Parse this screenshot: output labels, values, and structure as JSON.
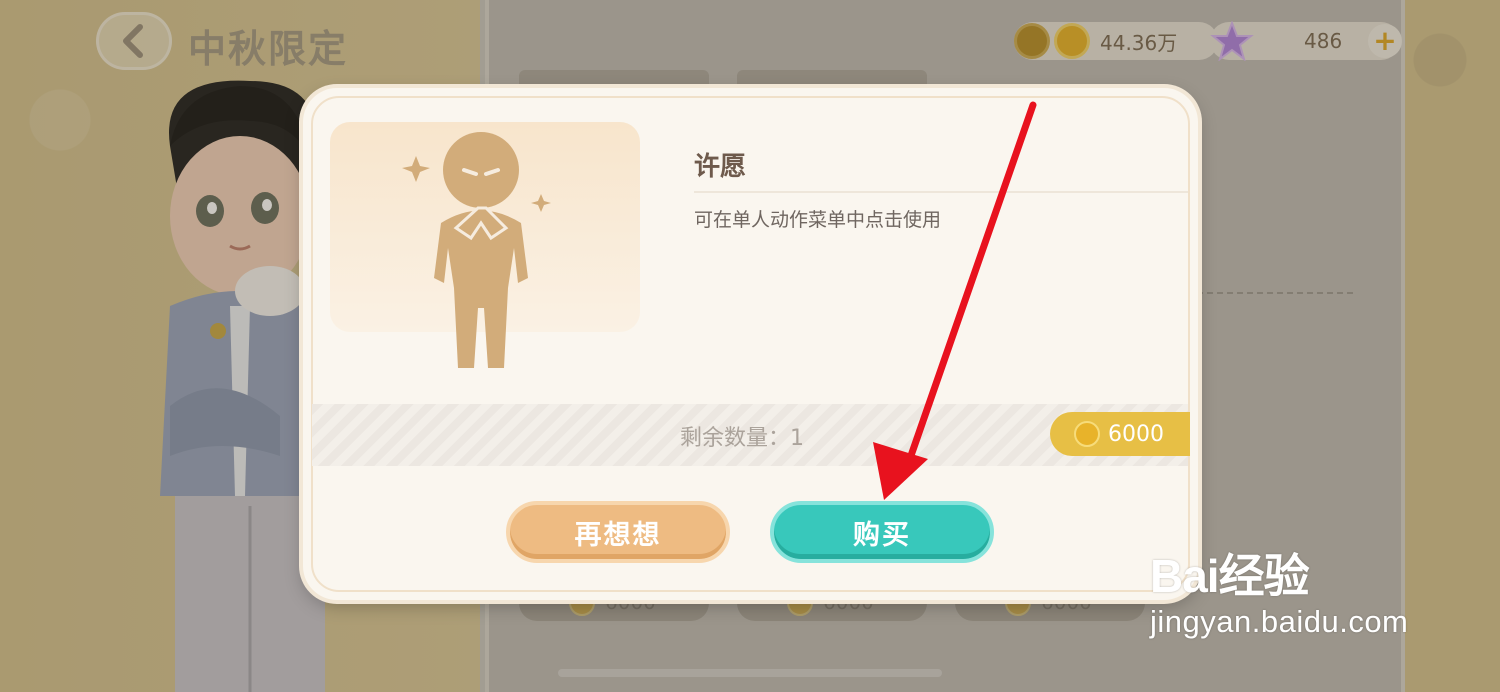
{
  "header": {
    "title": "中秋限定",
    "coins": "44.36万",
    "stars": "486",
    "plus": "+"
  },
  "modal": {
    "item_name": "许愿",
    "item_desc": "可在单人动作菜单中点击使用",
    "stock": "剩余数量：1",
    "price": "6000",
    "cancel_label": "再想想",
    "buy_label": "购买"
  },
  "shop": {
    "prices": [
      "6000",
      "6000",
      "6000"
    ]
  },
  "watermark": {
    "logo": "Bai经验",
    "url": "jingyan.baidu.com"
  },
  "colors": {
    "buy": "#38c8bb",
    "cancel": "#eebb82",
    "coin": "#e8b32a",
    "arrow": "#e8121e"
  }
}
